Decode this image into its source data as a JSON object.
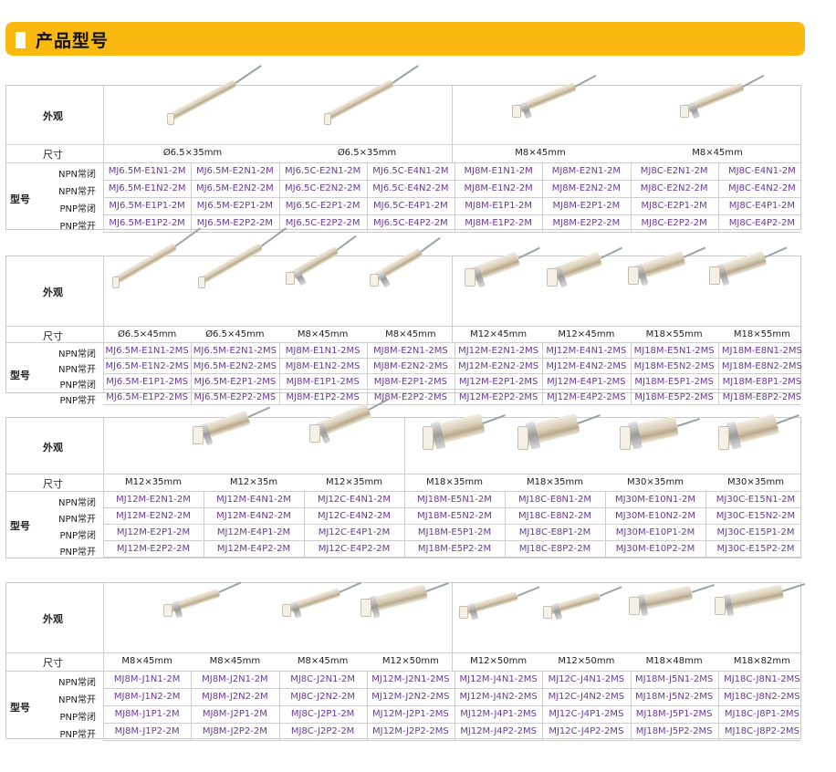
{
  "header": {
    "title": "产品型号"
  },
  "labels": {
    "appearance": "外观",
    "size": "尺寸",
    "model": "型号",
    "npn_nc": "NPN常闭",
    "npn_no": "NPN常开",
    "pnp_nc": "PNP常闭",
    "pnp_no": "PNP常开"
  },
  "tables": [
    {
      "sizes": [
        "Ø6.5×35mm",
        "Ø6.5×35mm",
        "M8×45mm",
        "M8×45mm"
      ],
      "models": [
        [
          "MJ6.5M-E1N1-2M",
          "MJ6.5M-E2N1-2M",
          "MJ6.5C-E2N1-2M",
          "MJ6.5C-E4N1-2M",
          "MJ8M-E1N1-2M",
          "MJ8M-E2N1-2M",
          "MJ8C-E2N1-2M",
          "MJ8C-E4N1-2M"
        ],
        [
          "MJ6.5M-E1N2-2M",
          "MJ6.5M-E2N2-2M",
          "MJ6.5C-E2N2-2M",
          "MJ6.5C-E4N2-2M",
          "MJ8M-E1N2-2M",
          "MJ8M-E2N2-2M",
          "MJ8C-E2N2-2M",
          "MJ8C-E4N2-2M"
        ],
        [
          "MJ6.5M-E1P1-2M",
          "MJ6.5M-E2P1-2M",
          "MJ6.5C-E2P1-2M",
          "MJ6.5C-E4P1-2M",
          "MJ8M-E1P1-2M",
          "MJ8M-E2P1-2M",
          "MJ8C-E2P1-2M",
          "MJ8C-E4P1-2M"
        ],
        [
          "MJ6.5M-E1P2-2M",
          "MJ6.5M-E2P2-2M",
          "MJ6.5C-E2P2-2M",
          "MJ6.5C-E4P2-2M",
          "MJ8M-E1P2-2M",
          "MJ8M-E2P2-2M",
          "MJ8C-E2P2-2M",
          "MJ8C-E4P2-2M"
        ]
      ]
    },
    {
      "sizes": [
        "Ø6.5×45mm",
        "Ø6.5×45mm",
        "M8×45mm",
        "M8×45mm",
        "M12×45mm",
        "M12×45mm",
        "M18×55mm",
        "M18×55mm"
      ],
      "models": [
        [
          "MJ6.5M-E1N1-2MS",
          "MJ6.5M-E2N1-2MS",
          "MJ8M-E1N1-2MS",
          "MJ8M-E2N1-2MS",
          "MJ12M-E2N1-2MS",
          "MJ12M-E4N1-2MS",
          "MJ18M-E5N1-2MS",
          "MJ18M-E8N1-2MS"
        ],
        [
          "MJ6.5M-E1N2-2MS",
          "MJ6.5M-E2N2-2MS",
          "MJ8M-E1N2-2MS",
          "MJ8M-E2N2-2MS",
          "MJ12M-E2N2-2MS",
          "MJ12M-E4N2-2MS",
          "MJ18M-E5N2-2MS",
          "MJ18M-E8N2-2MS"
        ],
        [
          "MJ6.5M-E1P1-2MS",
          "MJ6.5M-E2P1-2MS",
          "MJ8M-E1P1-2MS",
          "MJ8M-E2P1-2MS",
          "MJ12M-E2P1-2MS",
          "MJ12M-E4P1-2MS",
          "MJ18M-E5P1-2MS",
          "MJ18M-E8P1-2MS"
        ],
        [
          "MJ6.5M-E1P2-2MS",
          "MJ6.5M-E2P2-2MS",
          "MJ8M-E1P2-2MS",
          "MJ8M-E2P2-2MS",
          "MJ12M-E2P2-2MS",
          "MJ12M-E4P2-2MS",
          "MJ18M-E5P2-2MS",
          "MJ18M-E8P2-2MS"
        ]
      ]
    },
    {
      "sizes": [
        "M12×35mm",
        "M12×35m",
        "M12×35mm",
        "M18×35mm",
        "M18×35mm",
        "M30×35mm",
        "M30×35mm"
      ],
      "models": [
        [
          "MJ12M-E2N1-2M",
          "MJ12M-E4N1-2M",
          "MJ12C-E4N1-2M",
          "MJ18M-E5N1-2M",
          "MJ18C-E8N1-2M",
          "MJ30M-E10N1-2M",
          "MJ30C-E15N1-2M"
        ],
        [
          "MJ12M-E2N2-2M",
          "MJ12M-E4N2-2M",
          "MJ12C-E4N2-2M",
          "MJ18M-E5N2-2M",
          "MJ18C-E8N2-2M",
          "MJ30M-E10N2-2M",
          "MJ30C-E15N2-2M"
        ],
        [
          "MJ12M-E2P1-2M",
          "MJ12M-E4P1-2M",
          "MJ12C-E4P1-2M",
          "MJ18M-E5P1-2M",
          "MJ18C-E8P1-2M",
          "MJ30M-E10P1-2M",
          "MJ30C-E15P1-2M"
        ],
        [
          "MJ12M-E2P2-2M",
          "MJ12M-E4P2-2M",
          "MJ12C-E4P2-2M",
          "MJ18M-E5P2-2M",
          "MJ18C-E8P2-2M",
          "MJ30M-E10P2-2M",
          "MJ30C-E15P2-2M"
        ]
      ]
    },
    {
      "sizes": [
        "M8×45mm",
        "M8×45mm",
        "M8×45mm",
        "M12×50mm",
        "M12×50mm",
        "M12×50mm",
        "M18×48mm",
        "M18×82mm"
      ],
      "models": [
        [
          "MJ8M-J1N1-2M",
          "MJ8M-J2N1-2M",
          "MJ8C-J2N1-2M",
          "MJ12M-J2N1-2MS",
          "MJ12M-J4N1-2MS",
          "MJ12C-J4N1-2MS",
          "MJ18M-J5N1-2MS",
          "MJ18C-J8N1-2MS"
        ],
        [
          "MJ8M-J1N2-2M",
          "MJ8M-J2N2-2M",
          "MJ8C-J2N2-2M",
          "MJ12M-J2N2-2MS",
          "MJ12M-J4N2-2MS",
          "MJ12C-J4N2-2MS",
          "MJ18M-J5N2-2MS",
          "MJ18C-J8N2-2MS"
        ],
        [
          "MJ8M-J1P1-2M",
          "MJ8M-J2P1-2M",
          "MJ8C-J2P1-2M",
          "MJ12M-J2P1-2MS",
          "MJ12M-J4P1-2MS",
          "MJ12C-J4P1-2MS",
          "MJ18M-J5P1-2MS",
          "MJ18C-J8P1-2MS"
        ],
        [
          "MJ8M-J1P2-2M",
          "MJ8M-J2P2-2M",
          "MJ8C-J2P2-2M",
          "MJ12M-J2P2-2MS",
          "MJ12M-J4P2-2MS",
          "MJ12C-J4P2-2MS",
          "MJ18M-J5P2-2MS",
          "MJ18C-J8P2-2MS"
        ]
      ]
    }
  ]
}
